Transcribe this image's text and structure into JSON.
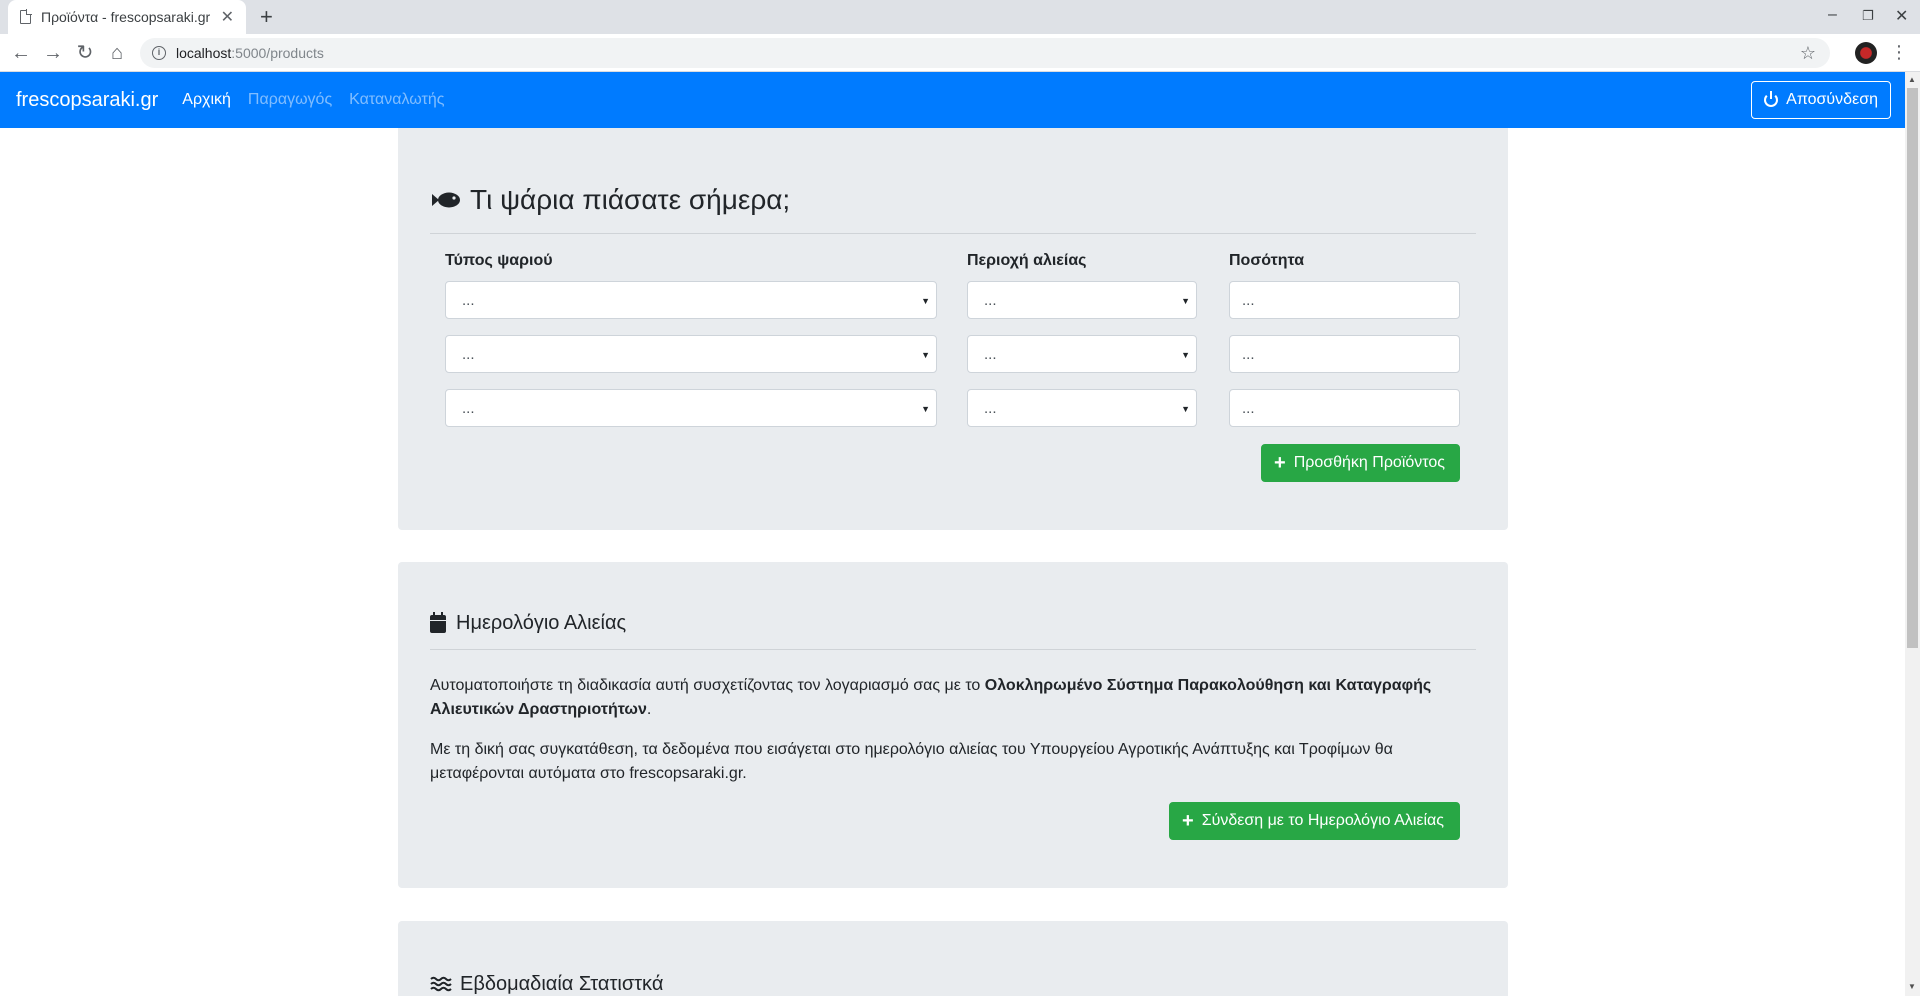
{
  "browser": {
    "tab_title": "Προϊόντα - frescopsaraki.gr",
    "url_host": "localhost",
    "url_path": ":5000/products"
  },
  "navbar": {
    "brand": "frescopsaraki.gr",
    "links": [
      "Αρχική",
      "Παραγωγός",
      "Καταναλωτής"
    ],
    "logout": "Αποσύνδεση"
  },
  "catch_form": {
    "title": "Τι ψάρια πιάσατε σήμερα;",
    "col_fish": "Τύπος ψαριού",
    "col_area": "Περιοχή αλιείας",
    "col_qty": "Ποσότητα",
    "rows": [
      {
        "fish": "...",
        "area": "...",
        "qty": "..."
      },
      {
        "fish": "...",
        "area": "...",
        "qty": "..."
      },
      {
        "fish": "...",
        "area": "...",
        "qty": "..."
      }
    ],
    "add_button": "Προσθήκη Προϊόντος"
  },
  "logbook": {
    "title": "Ημερολόγιο Αλιείας",
    "p1_pre": "Αυτοματοποιήστε τη διαδικασία αυτή συσχετίζοντας τον λογαριασμό σας με το ",
    "p1_bold": "Ολοκληρωμένο Σύστημα Παρακολούθηση και Καταγραφής Αλιευτικών Δραστηριοτήτων",
    "p1_post": ".",
    "p2": "Με τη δική σας συγκατάθεση, τα δεδομένα που εισάγεται στο ημερολόγιο αλιείας του Υπουργείου Αγροτικής Ανάπτυξης και Τροφίμων θα μεταφέρονται αυτόματα στο frescopsaraki.gr.",
    "connect_button": "Σύνδεση με το Ημερολόγιο Αλιείας"
  },
  "stats": {
    "title": "Εβδομαδιαία Στατιστκά"
  }
}
